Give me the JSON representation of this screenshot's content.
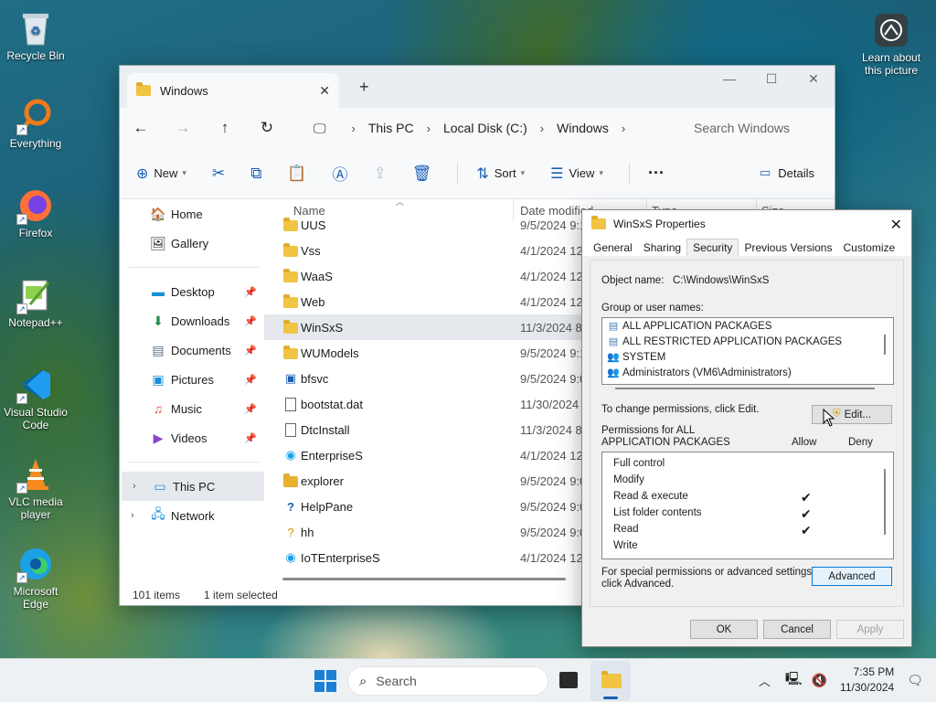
{
  "desktop": {
    "icons": [
      {
        "label": "Recycle Bin",
        "icon": "recycle-bin-icon"
      },
      {
        "label": "Everything",
        "icon": "search-icon"
      },
      {
        "label": "Firefox",
        "icon": "firefox-icon"
      },
      {
        "label": "Notepad++",
        "icon": "notepadpp-icon"
      },
      {
        "label": "Visual Studio Code",
        "icon": "vscode-icon"
      },
      {
        "label": "VLC media player",
        "icon": "vlc-icon"
      },
      {
        "label": "Microsoft Edge",
        "icon": "edge-icon"
      }
    ],
    "learn_label": "Learn about this picture"
  },
  "explorer": {
    "tab_title": "Windows",
    "new_tab": "+",
    "breadcrumb": [
      "This PC",
      "Local Disk (C:)",
      "Windows"
    ],
    "search_placeholder": "Search Windows",
    "toolbar": {
      "new_label": "New",
      "sort_label": "Sort",
      "view_label": "View",
      "more_label": "···",
      "details_label": "Details"
    },
    "sidebar": {
      "home": "Home",
      "gallery": "Gallery",
      "desktop": "Desktop",
      "downloads": "Downloads",
      "documents": "Documents",
      "pictures": "Pictures",
      "music": "Music",
      "videos": "Videos",
      "this_pc": "This PC",
      "network": "Network"
    },
    "columns": {
      "name": "Name",
      "date": "Date modified",
      "type": "Type",
      "size": "Size"
    },
    "files": [
      {
        "name": "UUS",
        "date": "9/5/2024 9:10",
        "kind": "folder"
      },
      {
        "name": "Vss",
        "date": "4/1/2024 12:2",
        "kind": "folder"
      },
      {
        "name": "WaaS",
        "date": "4/1/2024 12:2",
        "kind": "folder"
      },
      {
        "name": "Web",
        "date": "4/1/2024 12:2",
        "kind": "folder"
      },
      {
        "name": "WinSxS",
        "date": "11/3/2024 8:2",
        "kind": "folder"
      },
      {
        "name": "WUModels",
        "date": "9/5/2024 9:10",
        "kind": "folder"
      },
      {
        "name": "bfsvc",
        "date": "9/5/2024 9:02",
        "kind": "exe"
      },
      {
        "name": "bootstat.dat",
        "date": "11/30/2024 7",
        "kind": "file"
      },
      {
        "name": "DtcInstall",
        "date": "11/3/2024 8:1",
        "kind": "file"
      },
      {
        "name": "EnterpriseS",
        "date": "4/1/2024 12:2",
        "kind": "edge"
      },
      {
        "name": "explorer",
        "date": "9/5/2024 9:02",
        "kind": "folder"
      },
      {
        "name": "HelpPane",
        "date": "9/5/2024 9:02",
        "kind": "help"
      },
      {
        "name": "hh",
        "date": "9/5/2024 9:02",
        "kind": "hh"
      },
      {
        "name": "IoTEnterpriseS",
        "date": "4/1/2024 12:2",
        "kind": "edge"
      }
    ],
    "status": {
      "count": "101 items",
      "selected": "1 item selected"
    }
  },
  "props": {
    "title": "WinSxS Properties",
    "tabs": [
      "General",
      "Sharing",
      "Security",
      "Previous Versions",
      "Customize"
    ],
    "object_name_label": "Object name:",
    "object_name_value": "C:\\Windows\\WinSxS",
    "group_label": "Group or user names:",
    "groups": [
      "ALL APPLICATION PACKAGES",
      "ALL RESTRICTED APPLICATION PACKAGES",
      "SYSTEM",
      "Administrators (VM6\\Administrators)"
    ],
    "change_text": "To change permissions, click Edit.",
    "edit_label": "Edit...",
    "perm_for_line1": "Permissions for ALL",
    "perm_for_line2": "APPLICATION PACKAGES",
    "allow_label": "Allow",
    "deny_label": "Deny",
    "permissions": [
      {
        "name": "Full control",
        "allow": false
      },
      {
        "name": "Modify",
        "allow": false
      },
      {
        "name": "Read & execute",
        "allow": true
      },
      {
        "name": "List folder contents",
        "allow": true
      },
      {
        "name": "Read",
        "allow": true
      },
      {
        "name": "Write",
        "allow": false
      }
    ],
    "special_line1": "For special permissions or advanced settings,",
    "special_line2": "click Advanced.",
    "advanced_label": "Advanced",
    "ok_label": "OK",
    "cancel_label": "Cancel",
    "apply_label": "Apply"
  },
  "taskbar": {
    "search_placeholder": "Search",
    "time": "7:35 PM",
    "date": "11/30/2024"
  }
}
